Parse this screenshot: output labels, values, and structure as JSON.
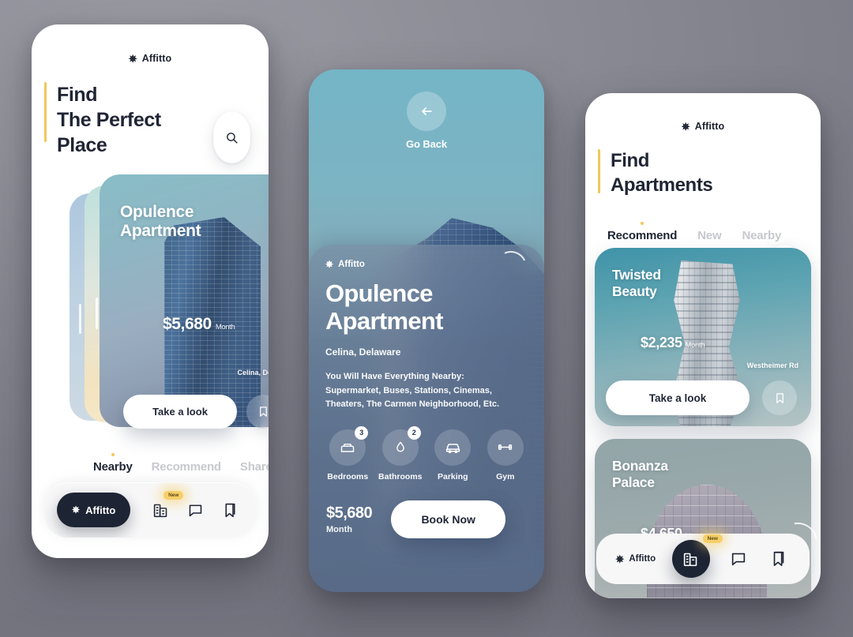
{
  "brand": {
    "name": "Affitto",
    "logo_icon": "asterisk-star-icon",
    "accent_color": "#f1c75c",
    "dark_color": "#1d2433"
  },
  "background_color": "#8b8b95",
  "phone1": {
    "headline": "Find\nThe Perfect\nPlace",
    "headline_lines": [
      "Find",
      "The Perfect",
      "Place"
    ],
    "search_icon": "search-icon",
    "featured_card": {
      "title_lines": [
        "Opulence",
        "Apartment"
      ],
      "price": "$5,680",
      "price_period": "Month",
      "address": "Celina, Delaware",
      "cta_label": "Take a look",
      "bookmark_icon": "bookmark-icon"
    },
    "tabs": [
      {
        "label": "Nearby",
        "active": true
      },
      {
        "label": "Recommend",
        "active": false
      },
      {
        "label": "Share",
        "active": false
      }
    ],
    "bottom_nav": {
      "brand_label": "Affitto",
      "items": [
        {
          "icon": "buildings-icon",
          "badge": "New"
        },
        {
          "icon": "chat-bubble-icon",
          "badge": ""
        },
        {
          "icon": "bookmark-icon",
          "badge": ""
        }
      ]
    }
  },
  "phone2": {
    "go_back_label": "Go Back",
    "back_icon": "arrow-left-icon",
    "brand_label": "Affitto",
    "title_lines": [
      "Opulence",
      "Apartment"
    ],
    "location": "Celina, Delaware",
    "description": "You Will Have Everything Nearby: Supermarket, Buses, Stations, Cinemas, Theaters, The Carmen Neighborhood, Etc.",
    "amenities": [
      {
        "label": "Bedrooms",
        "count": "3",
        "icon": "bed-icon"
      },
      {
        "label": "Bathrooms",
        "count": "2",
        "icon": "shower-drop-icon"
      },
      {
        "label": "Parking",
        "count": "",
        "icon": "car-icon"
      },
      {
        "label": "Gym",
        "count": "",
        "icon": "dumbbell-icon"
      }
    ],
    "price": "$5,680",
    "price_period": "Month",
    "book_label": "Book Now"
  },
  "phone3": {
    "headline_lines": [
      "Find",
      "Apartments"
    ],
    "filter_icon": "sliders-filter-icon",
    "tabs": [
      {
        "label": "Recommend",
        "active": true
      },
      {
        "label": "New",
        "active": false
      },
      {
        "label": "Nearby",
        "active": false
      }
    ],
    "listings": [
      {
        "title_lines": [
          "Twisted",
          "Beauty"
        ],
        "price": "$2,235",
        "price_period": "Month",
        "address": "Westheimer Rd",
        "cta_label": "Take a look",
        "bookmark_icon": "bookmark-icon"
      },
      {
        "title_lines": [
          "Bonanza",
          "Palace"
        ],
        "price": "$4,650",
        "price_period": "Month",
        "address": "",
        "cta_label": "",
        "bookmark_icon": ""
      }
    ],
    "bottom_nav": {
      "brand_label": "Affitto",
      "items": [
        {
          "icon": "buildings-icon",
          "badge": "New",
          "active": true
        },
        {
          "icon": "chat-bubble-icon",
          "badge": "",
          "active": false
        },
        {
          "icon": "bookmark-icon",
          "badge": "",
          "active": false
        }
      ]
    }
  }
}
